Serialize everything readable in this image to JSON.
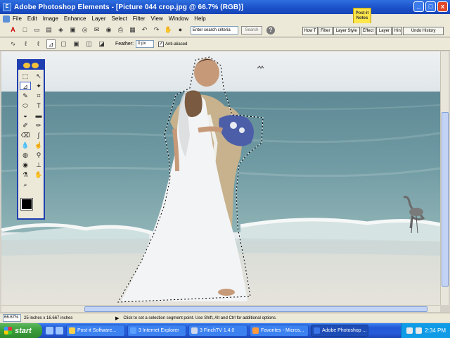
{
  "window": {
    "title": "Adobe Photoshop Elements - [Picture 044 crop.jpg @ 66.7% (RGB)]",
    "controls": [
      "_",
      "□",
      "x"
    ]
  },
  "menu": [
    "File",
    "Edit",
    "Image",
    "Enhance",
    "Layer",
    "Select",
    "Filter",
    "View",
    "Window",
    "Help"
  ],
  "postit": {
    "line1": "Post-it",
    "line2": "Notes"
  },
  "shortcuts": {
    "search_value": "Enter search criteria",
    "search_button": "Search",
    "help_button": "?"
  },
  "palette_tabs": [
    "How T",
    "Filter",
    "Layer Style",
    "Effect",
    "Layer",
    "Hin",
    "Undo History"
  ],
  "options": {
    "feather_label": "Feather:",
    "feather_value": "0 px",
    "antialias_label": "Anti-aliased",
    "antialias_checked": true
  },
  "status": {
    "zoom": "66.67%",
    "doc_size": "25 inches x 16.667 inches",
    "message": "Click to set a selection segment point.  Use Shift, Alt and Ctrl for additional options."
  },
  "colors": {
    "foreground": "#000000",
    "background": "#0a0ad8"
  },
  "taskbar": {
    "start_label": "start",
    "tasks": [
      {
        "label": "Post-it Software...",
        "active": false
      },
      {
        "label": "3 Internet Explorer",
        "active": false
      },
      {
        "label": "3 FinchTV 1.4.0",
        "active": false
      },
      {
        "label": "Favorites - Micros...",
        "active": false
      },
      {
        "label": "Adobe Photoshop ...",
        "active": true
      }
    ],
    "clock": "2:34 PM"
  }
}
